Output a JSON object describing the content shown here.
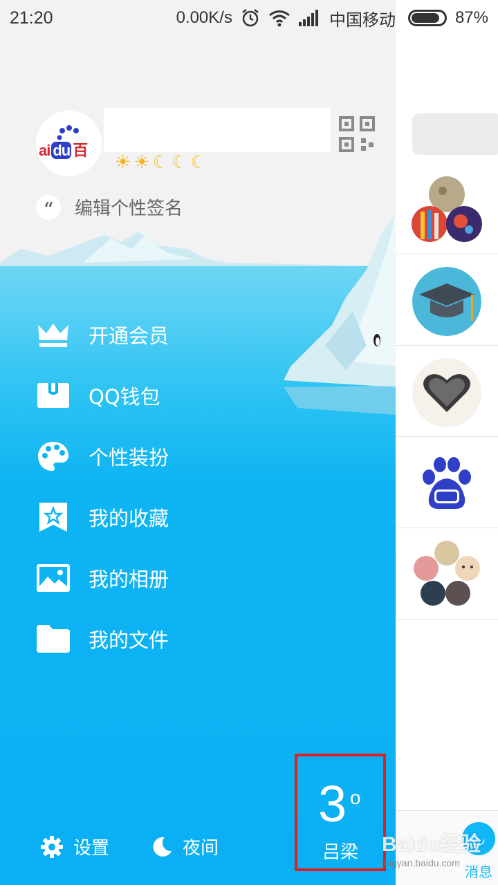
{
  "status_bar": {
    "time": "21:20",
    "speed": "0.00K/s",
    "carrier": "中国移动",
    "battery_percent": "87%",
    "battery_level": 0.87
  },
  "profile": {
    "avatar_brand": {
      "left": "ai",
      "du": "du",
      "right": "百"
    },
    "level_icons": [
      "sun",
      "sun",
      "moon",
      "moon",
      "moon"
    ],
    "signature_placeholder": "编辑个性签名"
  },
  "menu": [
    {
      "label": "开通会员",
      "icon": "crown-icon"
    },
    {
      "label": "QQ钱包",
      "icon": "wallet-icon"
    },
    {
      "label": "个性装扮",
      "icon": "palette-icon"
    },
    {
      "label": "我的收藏",
      "icon": "star-bookmark-icon"
    },
    {
      "label": "我的相册",
      "icon": "picture-icon"
    },
    {
      "label": "我的文件",
      "icon": "folder-icon"
    }
  ],
  "bottom": {
    "settings_label": "设置",
    "night_label": "夜间"
  },
  "weather": {
    "temperature": "3",
    "degree": "o",
    "city": "吕梁"
  },
  "panel": {
    "messages_label": "消息"
  },
  "watermark": {
    "brand": "Baidu经验",
    "url": "jingyan.baidu.com"
  },
  "colors": {
    "accent": "#12b7f5",
    "highlight_box": "#e02020"
  }
}
